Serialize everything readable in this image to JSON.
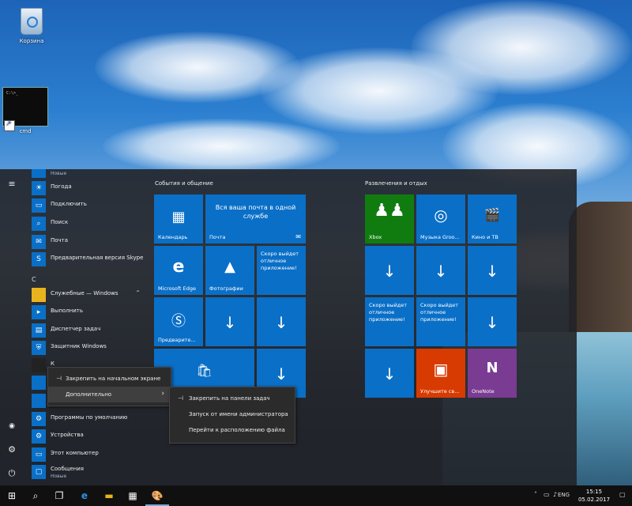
{
  "desktop": {
    "icons": [
      {
        "label": "Корзина"
      },
      {
        "label": "cmd"
      }
    ]
  },
  "start_menu": {
    "app_list": [
      {
        "label": "",
        "sub": "Новые"
      },
      {
        "label": "Погода"
      },
      {
        "label": "Подключить"
      },
      {
        "label": "Поиск"
      },
      {
        "label": "Почта"
      },
      {
        "label": "Предварительная версия Skype"
      },
      {
        "section": "С"
      },
      {
        "label": "Служебные — Windows"
      },
      {
        "label": "Выполнить"
      },
      {
        "label": "Диспетчер задач"
      },
      {
        "label": "Защитник Windows"
      },
      {
        "label": "К"
      },
      {
        "label": "Программы по умолчанию"
      },
      {
        "label": "Устройства"
      },
      {
        "label": "Этот компьютер"
      },
      {
        "label": "Сообщения",
        "sub": "Новые"
      }
    ],
    "groups": [
      {
        "title": "События и общение"
      },
      {
        "title": "Развлечения и отдых"
      }
    ],
    "tiles": {
      "calendar": "Календарь",
      "mail_text": "Вся ваша почта в одной службе",
      "mail": "Почта",
      "edge": "Microsoft Edge",
      "photos": "Фотографии",
      "soon1": "Скоро выйдет отличное приложение!",
      "skype": "Предварите...",
      "xbox": "Xbox",
      "groove": "Музыка Groo...",
      "movies": "Кино и ТВ",
      "soon2": "Скоро выйдет отличное приложение!",
      "soon3": "Скоро выйдет отличное приложение!",
      "office": "Улучшите св...",
      "onenote": "OneNote"
    }
  },
  "context_menu": {
    "items": [
      {
        "label": "Закрепить на начальном экране"
      },
      {
        "label": "Дополнительно"
      }
    ],
    "submenu": [
      {
        "label": "Закрепить на панели задач"
      },
      {
        "label": "Запуск от имени администратора"
      },
      {
        "label": "Перейти к расположению файла"
      }
    ]
  },
  "taskbar": {
    "lang": "ENG",
    "time": "15:15",
    "date": "05.02.2017"
  },
  "colors": {
    "tile_blue": "#0a6fc7",
    "office_red": "#d83b01",
    "onenote_purple": "#7a3b92",
    "xbox_green": "#107c10"
  }
}
